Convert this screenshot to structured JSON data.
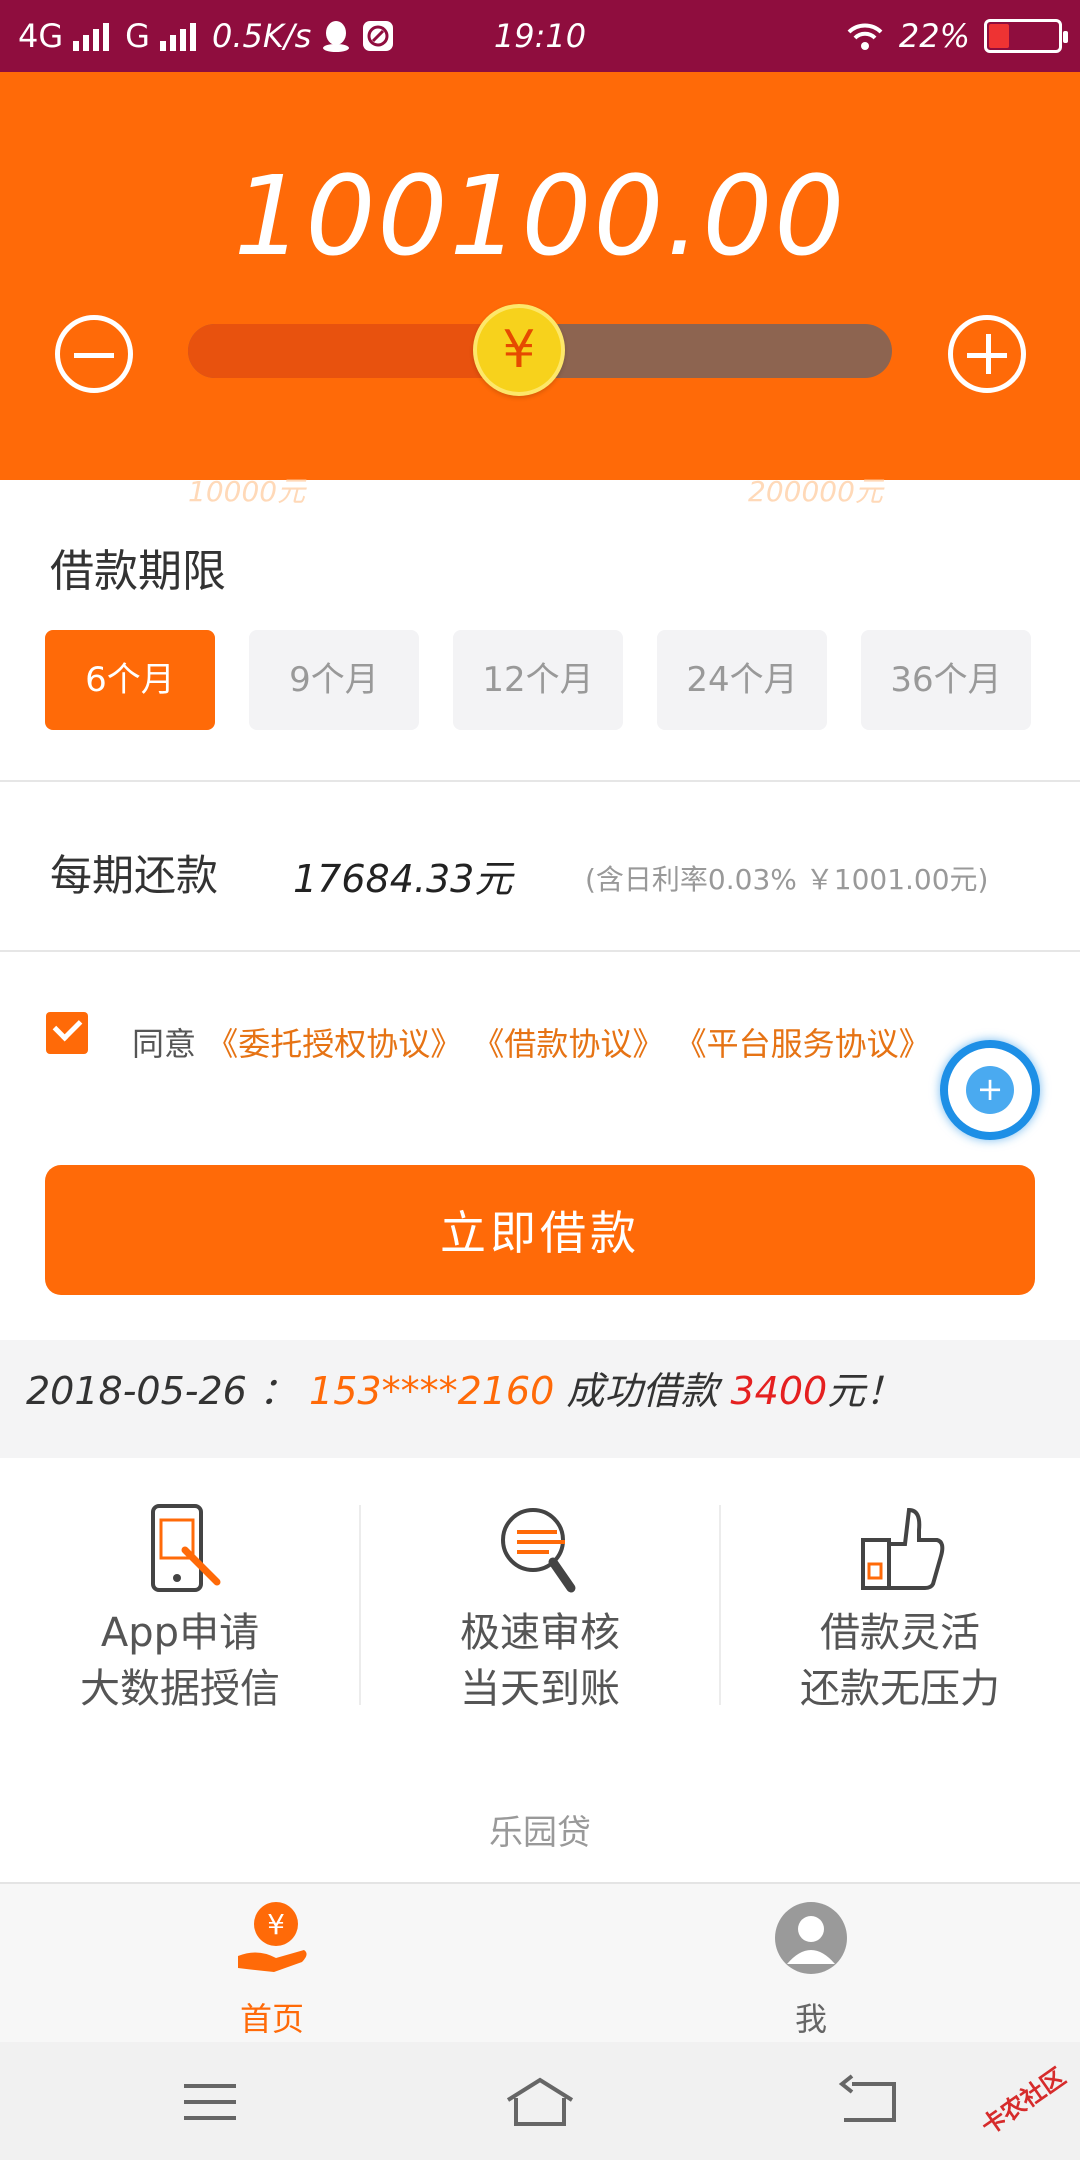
{
  "status_bar": {
    "net1": "4G",
    "net2": "G",
    "speed": "0.5K/s",
    "time": "19:10",
    "battery": "22%"
  },
  "loan": {
    "amount": "100100.00",
    "min_label": "10000元",
    "max_label": "200000元",
    "knob_symbol": "¥",
    "slider_fraction": 0.47
  },
  "term": {
    "title": "借款期限",
    "options": [
      "6个月",
      "9个月",
      "12个月",
      "24个月",
      "36个月"
    ],
    "selected": "6个月"
  },
  "repay": {
    "label": "每期还款",
    "value": "17684.33元",
    "note": "(含日利率0.03% ￥1001.00元)"
  },
  "agreement": {
    "prefix": "同意",
    "links": [
      "《委托授权协议》",
      "《借款协议》",
      "《平台服务协议》"
    ],
    "checked": true
  },
  "cta_label": "立即借款",
  "ticker": {
    "date": "2018-05-26",
    "sep": "：",
    "phone": "153****2160",
    "action": "成功借款",
    "amount": "3400",
    "suffix": "元！"
  },
  "features": [
    {
      "icon": "phone-tap-icon",
      "line1": "App申请",
      "line2": "大数据授信"
    },
    {
      "icon": "search-icon",
      "line1": "极速审核",
      "line2": "当天到账"
    },
    {
      "icon": "thumbs-up-icon",
      "line1": "借款灵活",
      "line2": "还款无压力"
    }
  ],
  "brand": "乐园贷",
  "tabs": [
    {
      "label": "首页",
      "icon": "home-yuan-icon",
      "active": true
    },
    {
      "label": "我",
      "icon": "user-avatar-icon",
      "active": false
    }
  ],
  "watermark": "卡农社区",
  "colors": {
    "accent": "#ff6a08",
    "status_bar": "#8f0d3e",
    "link": "#e67314",
    "alert_red": "#e52020",
    "float_blue": "#1d8fe6"
  }
}
